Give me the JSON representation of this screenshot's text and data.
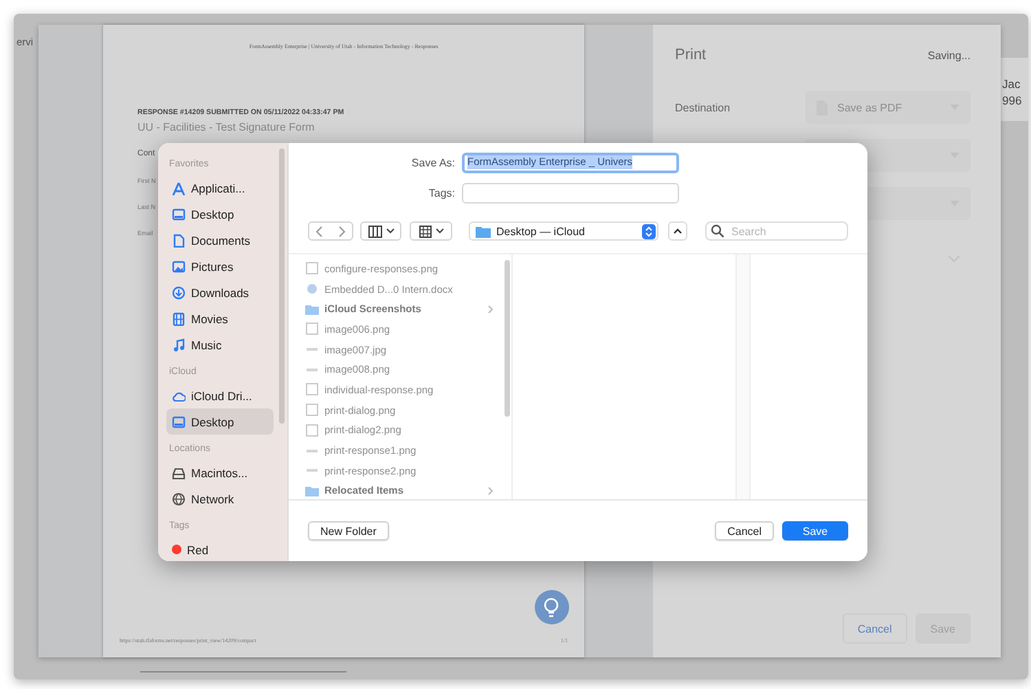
{
  "background_app": {
    "left_text": "ervi",
    "right_texts": [
      "Jac",
      "996"
    ]
  },
  "print_preview": {
    "page": {
      "header": "FormAssembly Enterprise | University of Utah - Information Technology - Responses",
      "response_heading": "RESPONSE #14209 SUBMITTED ON 05/11/2022 04:33:47 PM",
      "form_title": "UU - Facilities - Test Signature Form",
      "section": "Cont",
      "fields": [
        "First N",
        "Last N",
        "Email"
      ],
      "footer_url": "https://utah.tfaforms.net/responses/print_view/14209/compact",
      "page_number": "1/1"
    },
    "print_panel": {
      "title": "Print",
      "status": "Saving...",
      "destination_label": "Destination",
      "destination_value": "Save as PDF",
      "buttons": [
        {
          "label": "Cancel",
          "kind": "secondary"
        },
        {
          "label": "Save",
          "kind": "disabled"
        }
      ]
    }
  },
  "save_dialog": {
    "save_as_label": "Save As:",
    "save_as_value": "FormAssembly Enterprise _ Univers",
    "tags_label": "Tags:",
    "location": "Desktop — iCloud",
    "search": {
      "placeholder": "Search"
    },
    "sidebar": [
      {
        "heading": "Favorites",
        "items": [
          {
            "label": "Applicati...",
            "kind": "apps",
            "selected": false
          },
          {
            "label": "Desktop",
            "kind": "desktop",
            "selected": false
          },
          {
            "label": "Documents",
            "kind": "document",
            "selected": false
          },
          {
            "label": "Pictures",
            "kind": "pictures",
            "selected": false
          },
          {
            "label": "Downloads",
            "kind": "download",
            "selected": false
          },
          {
            "label": "Movies",
            "kind": "movies",
            "selected": false
          },
          {
            "label": "Music",
            "kind": "music",
            "selected": false
          }
        ]
      },
      {
        "heading": "iCloud",
        "items": [
          {
            "label": "iCloud Dri...",
            "kind": "cloud",
            "selected": false
          },
          {
            "label": "Desktop",
            "kind": "desktop",
            "selected": true
          }
        ]
      },
      {
        "heading": "Locations",
        "items": [
          {
            "label": "Macintos...",
            "kind": "disk",
            "selected": false
          },
          {
            "label": "Network",
            "kind": "network",
            "selected": false
          }
        ]
      },
      {
        "heading": "Tags",
        "items": [
          {
            "label": "Red",
            "kind": "tag",
            "color": "#ff3b30",
            "selected": false
          }
        ]
      }
    ],
    "files": [
      {
        "name": "configure-responses.png",
        "kind": "file"
      },
      {
        "name": "Embedded D...0 Intern.docx",
        "kind": "doc"
      },
      {
        "name": "iCloud Screenshots",
        "kind": "folder"
      },
      {
        "name": "image006.png",
        "kind": "file"
      },
      {
        "name": "image007.jpg",
        "kind": "thumb"
      },
      {
        "name": "image008.png",
        "kind": "thumb"
      },
      {
        "name": "individual-response.png",
        "kind": "file"
      },
      {
        "name": "print-dialog.png",
        "kind": "file"
      },
      {
        "name": "print-dialog2.png",
        "kind": "file"
      },
      {
        "name": "print-response1.png",
        "kind": "thumb"
      },
      {
        "name": "print-response2.png",
        "kind": "thumb"
      },
      {
        "name": "Relocated Items",
        "kind": "folder"
      }
    ],
    "buttons": [
      {
        "label": "New Folder",
        "kind": "plain"
      },
      {
        "label": "Cancel",
        "kind": "plain"
      },
      {
        "label": "Save",
        "kind": "default"
      }
    ]
  }
}
